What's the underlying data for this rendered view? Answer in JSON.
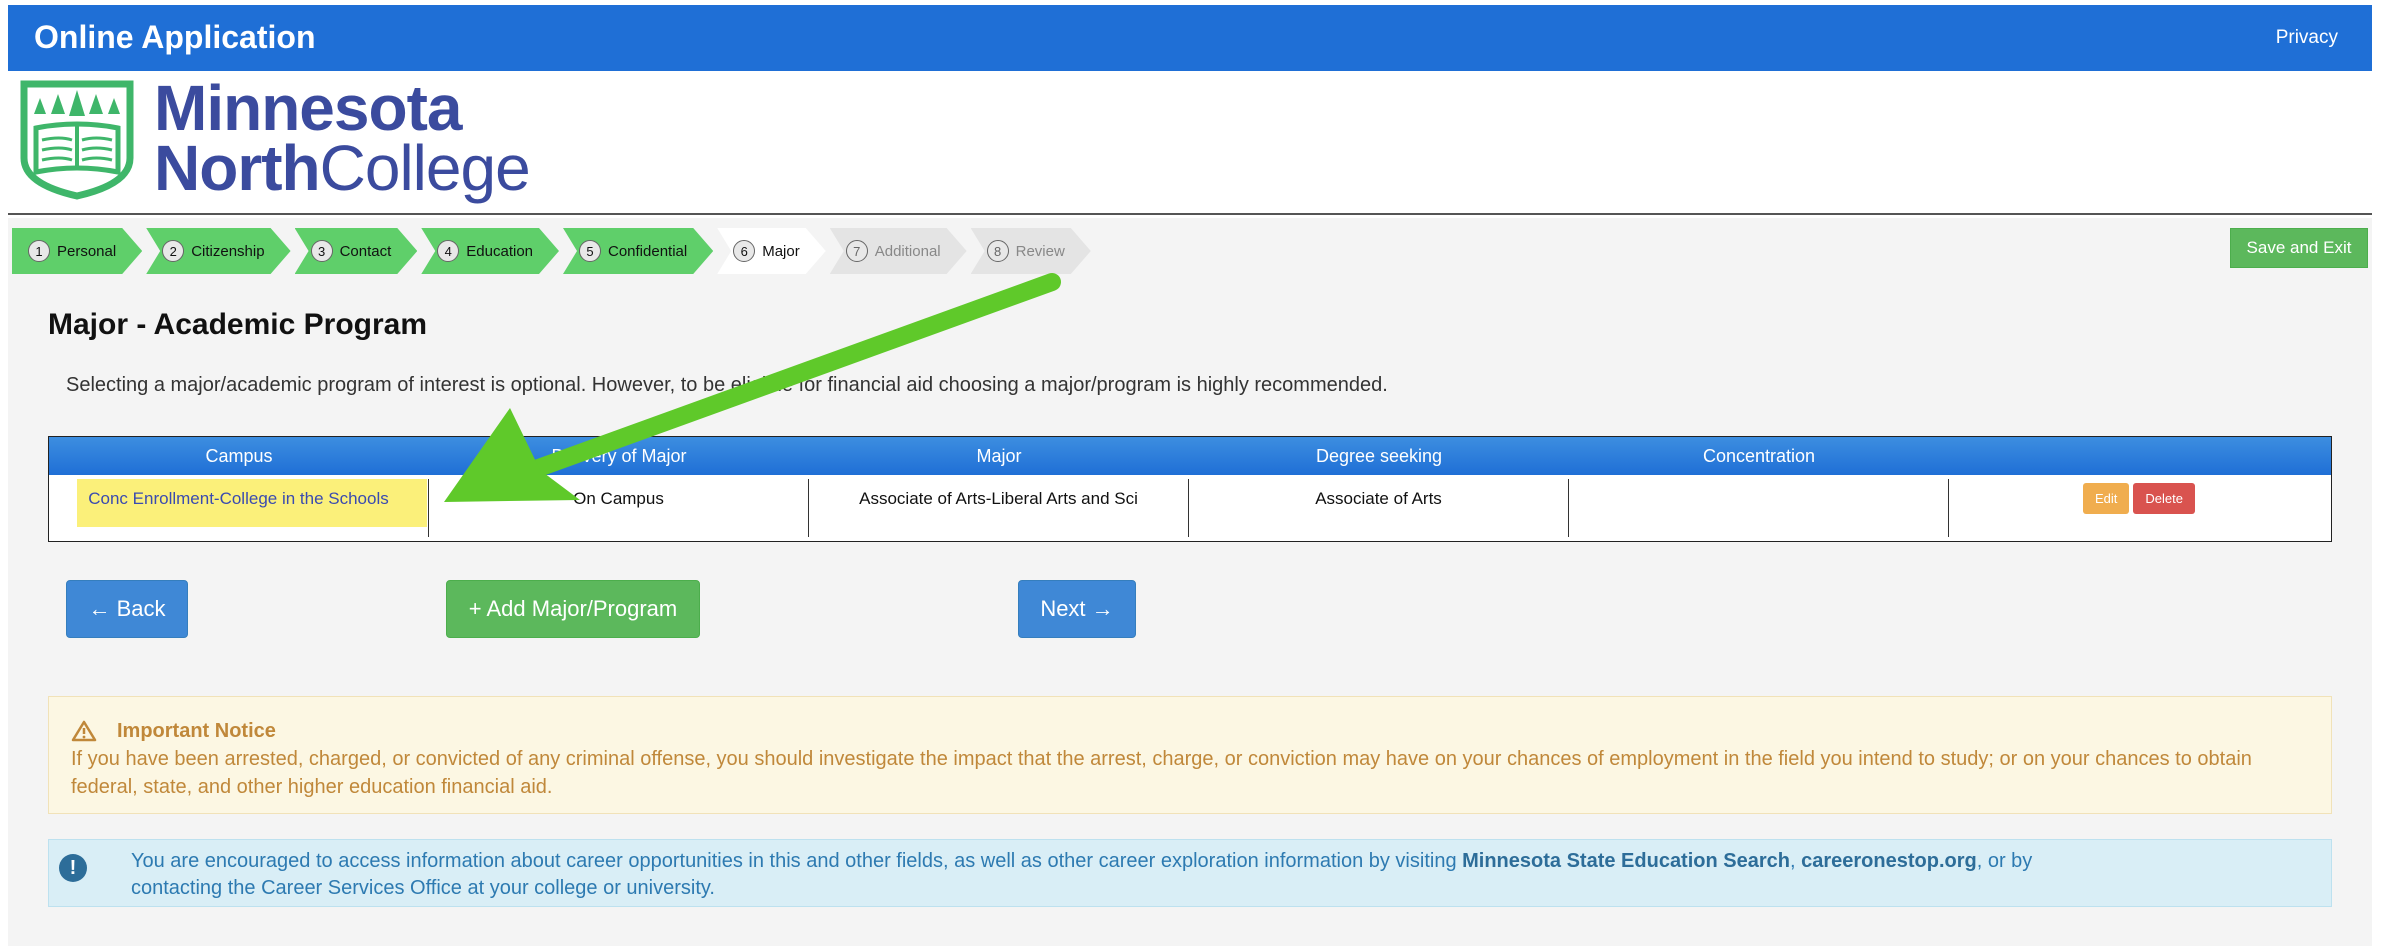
{
  "header": {
    "app_title": "Online Application",
    "privacy_link": "Privacy"
  },
  "logo": {
    "line1": "Minnesota",
    "line2_bold": "North",
    "line2_rest": "College",
    "color": "#3b4b9e",
    "icon_color": "#3fb66a"
  },
  "steps": [
    {
      "num": "1",
      "label": "Personal",
      "state": "done"
    },
    {
      "num": "2",
      "label": "Citizenship",
      "state": "done"
    },
    {
      "num": "3",
      "label": "Contact",
      "state": "done"
    },
    {
      "num": "4",
      "label": "Education",
      "state": "done"
    },
    {
      "num": "5",
      "label": "Confidential",
      "state": "done"
    },
    {
      "num": "6",
      "label": "Major",
      "state": "current"
    },
    {
      "num": "7",
      "label": "Additional",
      "state": "future"
    },
    {
      "num": "8",
      "label": "Review",
      "state": "future"
    }
  ],
  "save_exit": "Save and Exit",
  "page": {
    "title": "Major - Academic Program",
    "intro": "Selecting a major/academic program of interest is optional. However, to be eligible for financial aid choosing a major/program is highly recommended."
  },
  "table": {
    "headers": [
      "Campus",
      "Delivery of Major",
      "Major",
      "Degree seeking",
      "Concentration",
      ""
    ],
    "row": {
      "campus": "Conc Enrollment-College in the Schools",
      "delivery": "On Campus",
      "major": "Associate of Arts-Liberal Arts and Sci",
      "degree": "Associate of Arts",
      "concentration": "",
      "edit": "Edit",
      "delete": "Delete"
    }
  },
  "buttons": {
    "back": "← Back",
    "add": "+ Add Major/Program",
    "next": "Next →"
  },
  "notice": {
    "title": "Important Notice",
    "text": "If you have been arrested, charged, or convicted of any criminal offense, you should investigate the impact that the arrest, charge, or conviction may have on your chances of employment in the field you intend to study; or on your chances to obtain federal, state, and other higher education financial aid."
  },
  "info": {
    "text1": "You are encouraged to access information about career opportunities in this and other fields, as well as other career exploration information by visiting ",
    "link1": "Minnesota State Education Search",
    "sep": ", ",
    "link2": "careeronestop.org",
    "text2": ", or by",
    "text3": "contacting the Career Services Office at your college or university."
  },
  "annotation": {
    "arrow_color": "#5fc92a",
    "highlight_color": "#fbf07a"
  }
}
